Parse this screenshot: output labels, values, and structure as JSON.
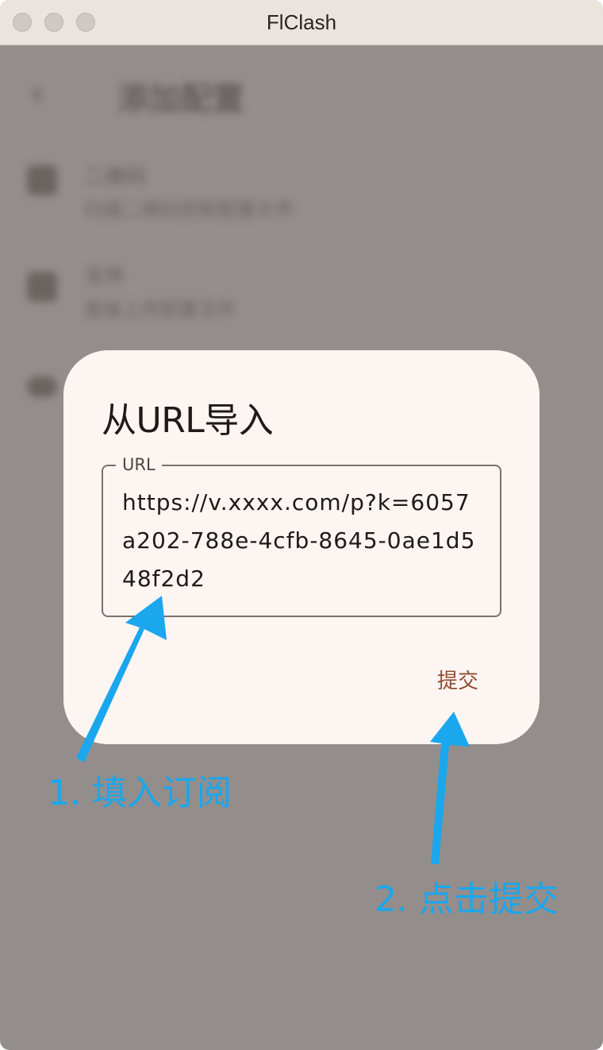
{
  "window": {
    "title": "FlClash"
  },
  "background_page": {
    "back_icon": "chevron-left-icon",
    "title": "添加配置",
    "items": [
      {
        "icon": "qr-code-icon",
        "title": "二维码",
        "subtitle": "扫描二维码获取配置文件"
      },
      {
        "icon": "file-icon",
        "title": "文件",
        "subtitle": "直接上传配置文件"
      },
      {
        "icon": "cloud-icon",
        "title": "",
        "subtitle": ""
      }
    ]
  },
  "dialog": {
    "title": "从URL导入",
    "url_field": {
      "label": "URL",
      "value": "https://v.xxxx.com/p?k=6057a202-788e-4cfb-8645-0ae1d548f2d2"
    },
    "submit_label": "提交"
  },
  "annotations": {
    "step1": "1. 填入订阅",
    "step2": "2. 点击提交",
    "arrow_color": "#1aa7ee"
  },
  "colors": {
    "scrim": "#938e8b",
    "dialog_bg": "#fcf5f2",
    "accent": "#8f4b30",
    "annotation": "#1aa7ee"
  }
}
